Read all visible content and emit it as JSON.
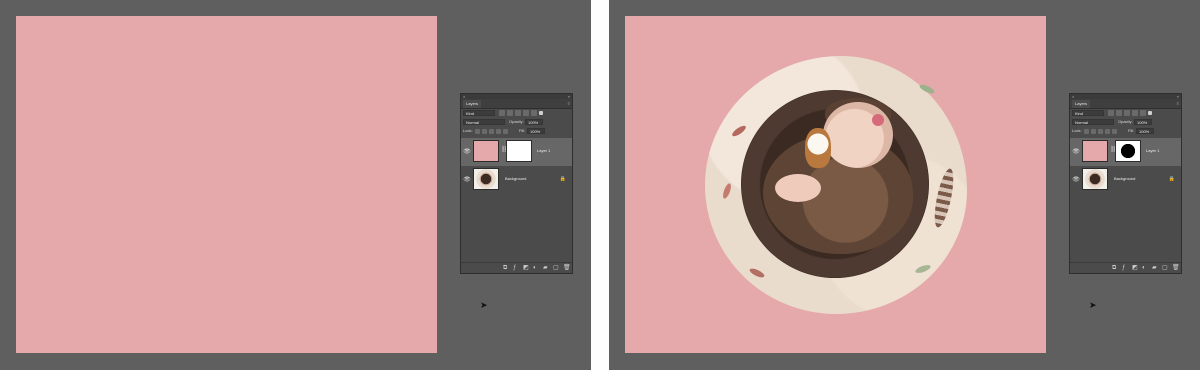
{
  "colors": {
    "workspace": "#5f5f5f",
    "canvas_pink": "#e6a9ab",
    "panel": "#4b4b4b",
    "panel_dark": "#3c3c3c",
    "selected_row": "#676767",
    "mask_white": "#ffffff",
    "mask_black": "#000000"
  },
  "icons": {
    "close": "×",
    "collapse": "»",
    "menu": "≡",
    "eye": "👁",
    "chain": "⛓",
    "lock": "🔒",
    "cursor": "➤"
  },
  "panes": [
    {
      "panel": {
        "tab": "Layers",
        "filter": "Kind",
        "blend_mode": "Normal",
        "opacity_label": "Opacity:",
        "opacity_value": "100%",
        "lock_label": "Lock:",
        "fill_label": "Fill:",
        "fill_value": "100%",
        "layers": [
          {
            "name": "Layer 1"
          },
          {
            "name": "Background"
          }
        ]
      }
    },
    {
      "panel": {
        "tab": "Layers",
        "filter": "Kind",
        "blend_mode": "Normal",
        "opacity_label": "Opacity:",
        "opacity_value": "100%",
        "lock_label": "Lock:",
        "fill_label": "Fill:",
        "fill_value": "100%",
        "layers": [
          {
            "name": "Layer 1"
          },
          {
            "name": "Background"
          }
        ]
      }
    }
  ]
}
